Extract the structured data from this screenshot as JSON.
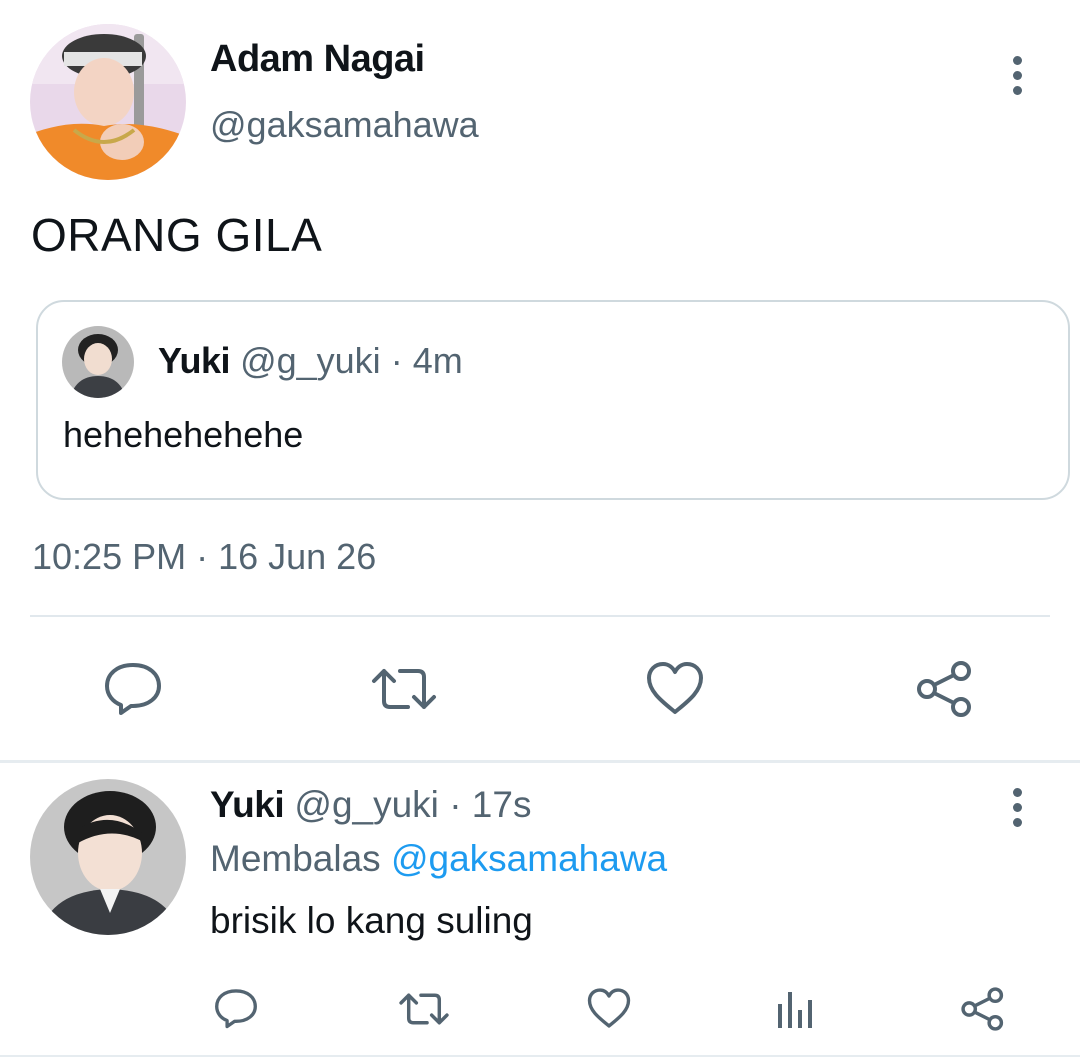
{
  "tweet": {
    "author": {
      "display_name": "Adam Nagai",
      "handle": "@gaksamahawa",
      "avatar": "avatar-adam"
    },
    "text": "ORANG GILA",
    "quote": {
      "display_name": "Yuki",
      "handle": "@g_yuki",
      "separator": "·",
      "time": "4m",
      "text": "hehehehehehe",
      "avatar": "avatar-yuki"
    },
    "timestamp": "10:25 PM · 16 Jun 26",
    "actions": [
      "reply-icon",
      "retweet-icon",
      "like-icon",
      "share-icon"
    ],
    "menu_icon": "more-vertical-icon"
  },
  "reply": {
    "author": {
      "display_name": "Yuki",
      "handle": "@g_yuki",
      "separator": "·",
      "time": "17s",
      "avatar": "avatar-yuki"
    },
    "replying_label": "Membalas",
    "replying_to": "@gaksamahawa",
    "text": "brisik lo kang suling",
    "actions": [
      "reply-icon",
      "retweet-icon",
      "like-icon",
      "analytics-icon",
      "share-icon"
    ],
    "menu_icon": "more-vertical-icon"
  },
  "colors": {
    "text": "#0f1419",
    "secondary": "#536471",
    "link": "#1d9bf0",
    "border": "#cfd9de",
    "divider": "#e1e8ed"
  }
}
